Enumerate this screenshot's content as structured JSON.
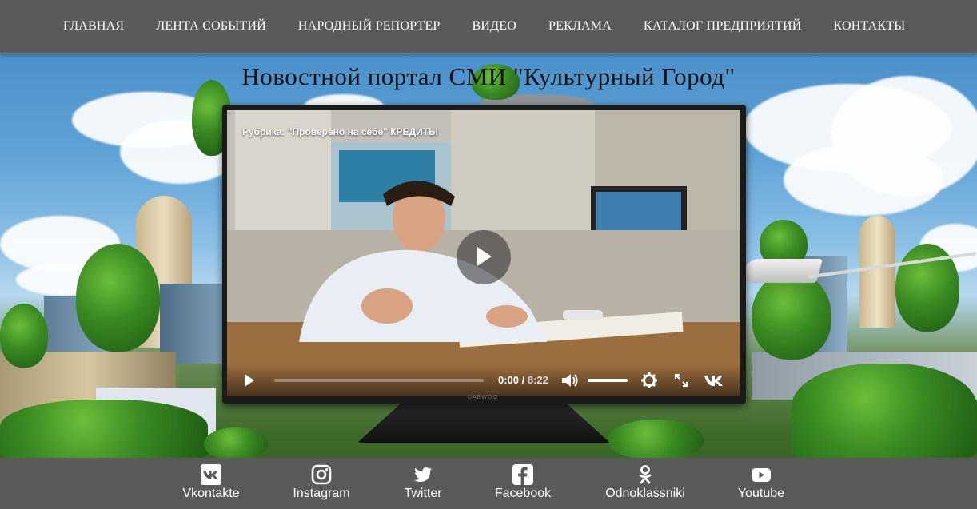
{
  "nav": {
    "items": [
      {
        "label": "ГЛАВНАЯ"
      },
      {
        "label": "ЛЕНТА СОБЫТИЙ"
      },
      {
        "label": "НАРОДНЫЙ РЕПОРТЕР"
      },
      {
        "label": "ВИДЕО"
      },
      {
        "label": "РЕКЛАМА"
      },
      {
        "label": "КАТАЛОГ ПРЕДПРИЯТИЙ"
      },
      {
        "label": "КОНТАКТЫ"
      }
    ]
  },
  "page": {
    "title": "Новостной портал СМИ \"Культурный Город\""
  },
  "video": {
    "caption": "Рубрика: \"Проверено на себе\" КРЕДИТЫ",
    "current_time": "0:00",
    "separator": " / ",
    "duration": "8:22",
    "brand": "DAEWOO",
    "icons": [
      "play-icon",
      "volume-icon",
      "settings-icon",
      "fullscreen-icon",
      "vk-icon"
    ]
  },
  "footer": {
    "links": [
      {
        "label": "Vkontakte",
        "icon": "vk-icon"
      },
      {
        "label": "Instagram",
        "icon": "instagram-icon"
      },
      {
        "label": "Twitter",
        "icon": "twitter-icon"
      },
      {
        "label": "Facebook",
        "icon": "facebook-icon"
      },
      {
        "label": "Odnoklassniki",
        "icon": "odnoklassniki-icon"
      },
      {
        "label": "Youtube",
        "icon": "youtube-icon"
      }
    ]
  },
  "colors": {
    "bar_bg": "#5a5a5a",
    "bar_text": "#ffffff",
    "title_text": "#111111"
  }
}
